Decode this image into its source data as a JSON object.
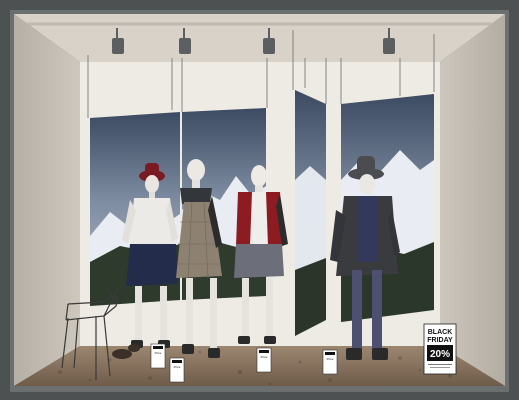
{
  "scene": {
    "subject": "shop window display",
    "colors": {
      "frame": "#55595a",
      "wall": "#c3bdb3",
      "ceiling": "#d6d0c6",
      "sky": "#4a5a70",
      "snow": "#e8ecf2",
      "floor": "#8a7560",
      "sweater_red": "#8c1c22"
    }
  },
  "price_tags": [
    {
      "label": "Price"
    },
    {
      "label": "Price"
    },
    {
      "label": "Price"
    },
    {
      "label": "Price"
    }
  ],
  "sale_sign": {
    "line1": "BLACK",
    "line2": "FRIDAY",
    "discount": "20%"
  }
}
